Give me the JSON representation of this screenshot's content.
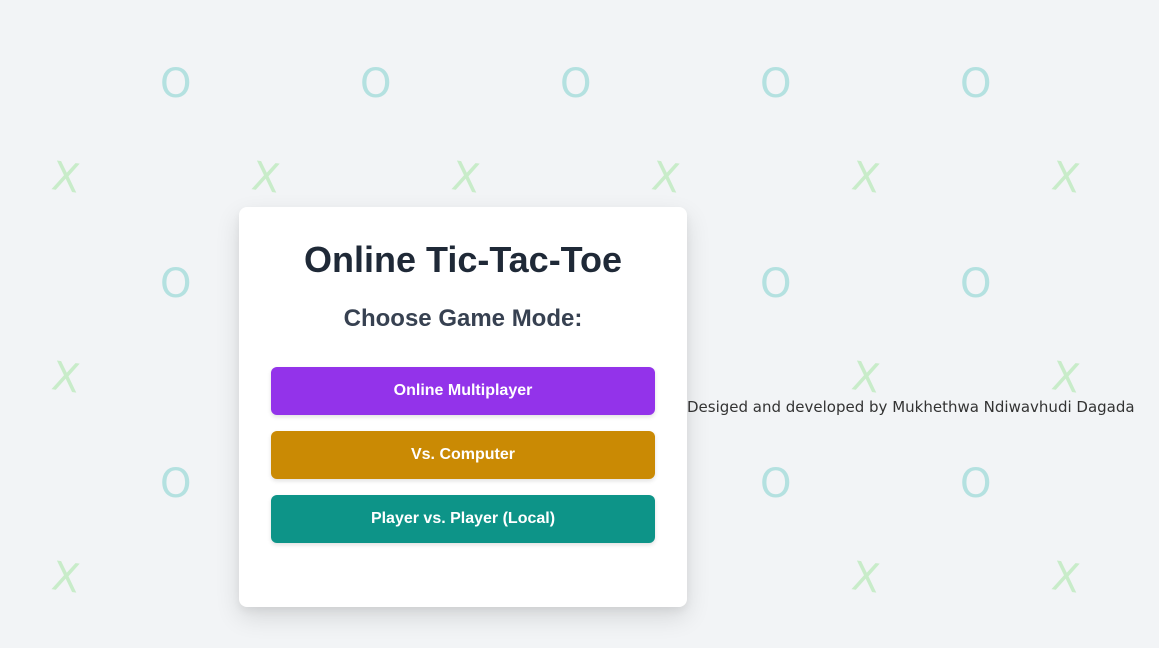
{
  "background": {
    "o_mark": "O",
    "x_mark": "X",
    "o_color": "#b4e1e0",
    "x_color": "#c8ecc9",
    "page_color": "#f2f4f6"
  },
  "card": {
    "title": "Online Tic-Tac-Toe",
    "subtitle": "Choose Game Mode:",
    "buttons": [
      {
        "label": "Online Multiplayer",
        "color": "#9333ea"
      },
      {
        "label": "Vs. Computer",
        "color": "#ca8a04"
      },
      {
        "label": "Player vs. Player (Local)",
        "color": "#0d9488"
      }
    ]
  },
  "footer": {
    "credit": "Desiged and developed by Mukhethwa Ndiwavhudi Dagada"
  }
}
